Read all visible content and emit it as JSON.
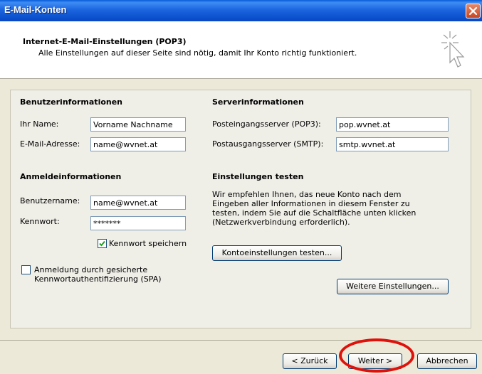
{
  "window": {
    "title": "E-Mail-Konten"
  },
  "header": {
    "title": "Internet-E-Mail-Einstellungen (POP3)",
    "subtitle": "Alle Einstellungen auf dieser Seite sind nötig, damit Ihr Konto richtig funktioniert."
  },
  "user_info": {
    "heading": "Benutzerinformationen",
    "name_label": "Ihr Name:",
    "name_value": "Vorname Nachname",
    "email_label": "E-Mail-Adresse:",
    "email_value": "name@wvnet.at"
  },
  "server_info": {
    "heading": "Serverinformationen",
    "incoming_label": "Posteingangsserver (POP3):",
    "incoming_value": "pop.wvnet.at",
    "outgoing_label": "Postausgangsserver (SMTP):",
    "outgoing_value": "smtp.wvnet.at"
  },
  "logon_info": {
    "heading": "Anmeldeinformationen",
    "username_label": "Benutzername:",
    "username_value": "name@wvnet.at",
    "password_label": "Kennwort:",
    "password_value": "*******",
    "remember_label": "Kennwort speichern",
    "remember_checked": true,
    "spa_label": "Anmeldung durch gesicherte Kennwortauthentifizierung (SPA)",
    "spa_checked": false
  },
  "test_settings": {
    "heading": "Einstellungen testen",
    "description": "Wir empfehlen Ihnen, das neue Konto nach dem Eingeben aller Informationen in diesem Fenster zu testen, indem Sie auf die Schaltfläche unten klicken (Netzwerkverbindung erforderlich).",
    "test_button": "Kontoeinstellungen testen...",
    "more_settings_button": "Weitere Einstellungen..."
  },
  "footer": {
    "back_button": "< Zurück",
    "next_button": "Weiter >",
    "cancel_button": "Abbrechen"
  },
  "colors": {
    "titlebar": "#0A5CD8",
    "highlight": "#E0100A",
    "check": "#21A121"
  }
}
